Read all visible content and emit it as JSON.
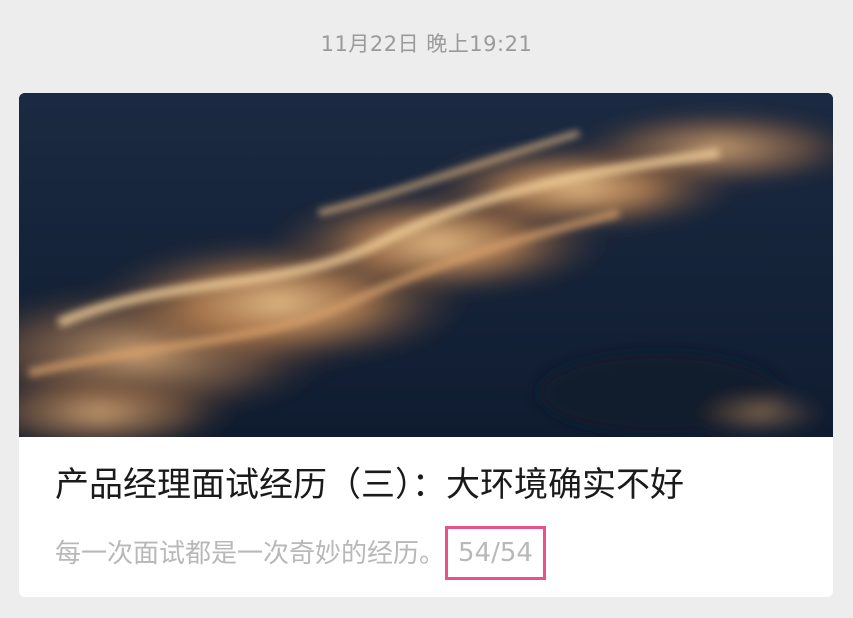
{
  "timestamp": "11月22日 晚上19:21",
  "article": {
    "title": "产品经理面试经历（三）：大环境确实不好",
    "description": "每一次面试都是一次奇妙的经历。",
    "counter": "54/54",
    "highlight_color": "#e8528a",
    "cover_image": "cloud-sunset-image"
  },
  "colors": {
    "background": "#ededed",
    "card": "#ffffff",
    "title_text": "#1a1a1a",
    "secondary_text": "#b8b8b8"
  }
}
